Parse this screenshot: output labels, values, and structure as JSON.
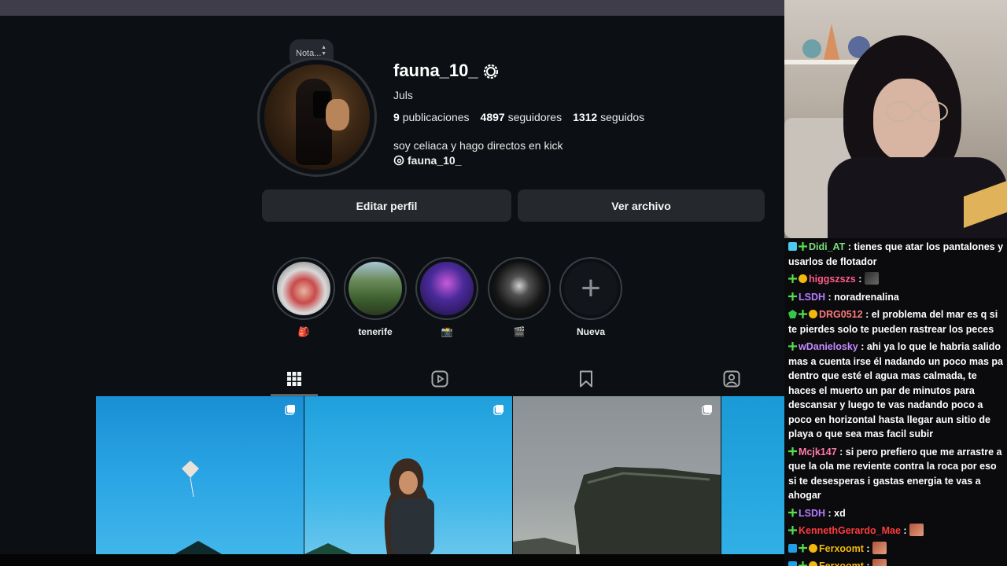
{
  "profile": {
    "note_label": "Nota...",
    "username": "fauna_10_",
    "full_name": "Juls",
    "stats": {
      "posts_count": "9",
      "posts_label": "publicaciones",
      "followers_count": "4897",
      "followers_label": "seguidores",
      "following_count": "1312",
      "following_label": "seguidos"
    },
    "bio": "soy celiaca y hago directos en kick",
    "threads_handle": "fauna_10_"
  },
  "buttons": {
    "edit_profile": "Editar perfil",
    "view_archive": "Ver archivo"
  },
  "highlights": [
    {
      "label": "🎒"
    },
    {
      "label": "tenerife"
    },
    {
      "label": "📸"
    },
    {
      "label": "🎬"
    },
    {
      "label": "Nueva"
    }
  ],
  "tabs": [
    "grid-icon",
    "reels-icon",
    "saved-icon",
    "tagged-icon"
  ],
  "chat": {
    "messages": [
      {
        "user": "Didi_AT",
        "color": "#7be07b",
        "badges": [
          "boost",
          "green"
        ],
        "text": "tienes que atar los pantalones y usarlos de flotador"
      },
      {
        "user": "higgszszs",
        "color": "#ff5c8a",
        "badges": [
          "green",
          "sub"
        ],
        "text": "",
        "emote": "dark"
      },
      {
        "user": "LSDH",
        "color": "#b57bff",
        "badges": [
          "green"
        ],
        "text": "noradrenalina"
      },
      {
        "user": "DRG0512",
        "color": "#ff7a7a",
        "badges": [
          "gem",
          "green",
          "sub"
        ],
        "text": "el problema del mar es q si te pierdes solo te pueden rastrear los peces"
      },
      {
        "user": "wDanielosky",
        "color": "#c58cff",
        "badges": [
          "green"
        ],
        "text": "ahi ya lo que le habria salido mas a cuenta irse él nadando un poco mas pa dentro que esté el agua mas calmada, te haces el muerto un par de minutos para descansar y luego te vas nadando poco a poco en horizontal hasta llegar aun sitio de playa o que sea mas facil subir"
      },
      {
        "user": "Mcjk147",
        "color": "#ff7aa8",
        "badges": [
          "green"
        ],
        "text": "si pero prefiero que me arrastre a que la ola me reviente contra la roca por eso si te desesperas i gastas energia te vas a ahogar"
      },
      {
        "user": "LSDH",
        "color": "#b57bff",
        "badges": [
          "green"
        ],
        "text": "xd"
      },
      {
        "user": "KennethGerardo_Mae",
        "color": "#ff3b3b",
        "badges": [
          "green"
        ],
        "text": "",
        "emote": "red"
      },
      {
        "user": "Ferxoomt",
        "color": "#f2b90c",
        "badges": [
          "mod",
          "green",
          "sub"
        ],
        "text": "",
        "emote": "red"
      },
      {
        "user": "Ferxoomt",
        "color": "#f2b90c",
        "badges": [
          "mod",
          "green",
          "sub"
        ],
        "text": "",
        "emote": "red"
      },
      {
        "user": "Ferxoomt",
        "color": "#f2b90c",
        "badges": [
          "mod",
          "green",
          "sub"
        ],
        "text": "",
        "emote": "red"
      }
    ]
  }
}
